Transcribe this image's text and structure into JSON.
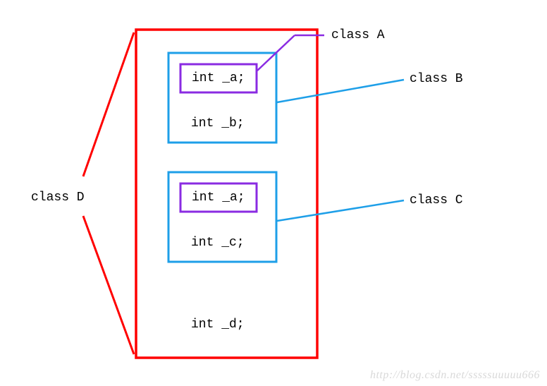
{
  "labels": {
    "classA": "class A",
    "classB": "class B",
    "classC": "class C",
    "classD": "class D"
  },
  "members": {
    "int_a1": "int _a;",
    "int_b": "int _b;",
    "int_a2": "int _a;",
    "int_c": "int _c;",
    "int_d": "int _d;"
  },
  "watermark": "http://blog.csdn.net/sssssuuuuu666",
  "colors": {
    "red": "#ff0000",
    "blue": "#1e9fe8",
    "purple": "#8a2be2"
  }
}
